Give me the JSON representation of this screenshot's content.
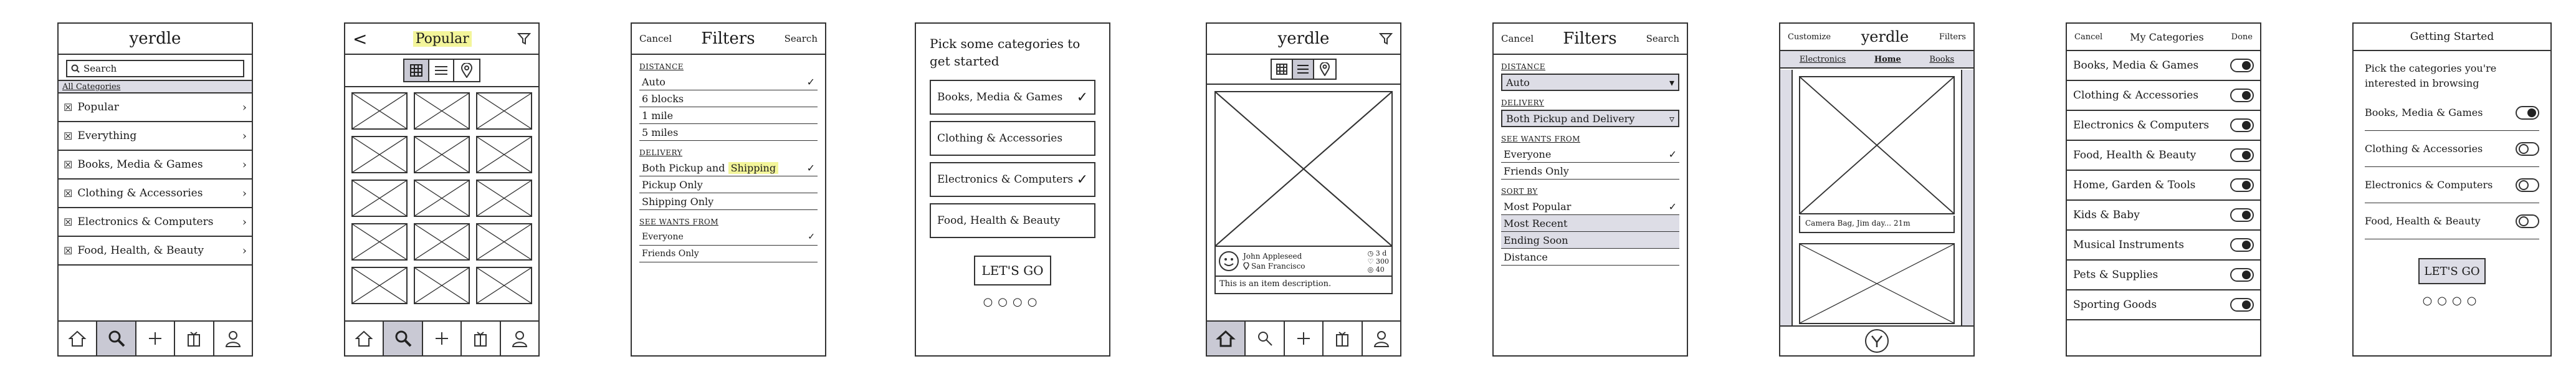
{
  "s1": {
    "title": "yerdle",
    "search_placeholder": "Search",
    "section": "All Categories",
    "items": [
      {
        "label": "Popular",
        "icon": "checkbox-icon"
      },
      {
        "label": "Everything",
        "icon": "checkbox-icon"
      },
      {
        "label": "Books, Media & Games",
        "icon": "checkbox-icon"
      },
      {
        "label": "Clothing & Accessories",
        "icon": "checkbox-icon"
      },
      {
        "label": "Electronics & Computers",
        "icon": "checkbox-icon"
      },
      {
        "label": "Food, Health, & Beauty",
        "icon": "checkbox-icon"
      }
    ],
    "tabs": [
      "home-icon",
      "search-icon",
      "plus-icon",
      "gift-icon",
      "profile-icon"
    ]
  },
  "s2": {
    "back": "<",
    "title": "Popular",
    "view_icons": [
      "grid-icon",
      "list-icon",
      "map-pin-icon"
    ]
  },
  "s3": {
    "cancel": "Cancel",
    "title": "Filters",
    "search": "Search",
    "distance_header": "Distance",
    "distance": [
      "Auto",
      "6 blocks",
      "1 mile",
      "5 miles"
    ],
    "delivery_header": "Delivery",
    "delivery_prefix": "Both Pickup and ",
    "delivery_highlight": "Shipping",
    "delivery": [
      "Pickup Only",
      "Shipping Only"
    ],
    "wants_header": "See wants from",
    "wants": [
      "Everyone",
      "Friends Only"
    ]
  },
  "s4": {
    "prompt": "Pick some categories to get started",
    "cards": [
      "Books, Media & Games",
      "Clothing & Accessories",
      "Electronics & Computers",
      "Food, Health & Beauty"
    ],
    "button": "LET'S GO",
    "dots": "○○○○"
  },
  "s5": {
    "title": "yerdle",
    "user": "John Appleseed",
    "location": "San Francisco",
    "stats": [
      "3 d",
      "300",
      "40"
    ],
    "description": "This is an item description."
  },
  "s6": {
    "cancel": "Cancel",
    "title": "Filters",
    "search": "Search",
    "distance_header": "Distance",
    "distance_value": "Auto",
    "delivery_header": "Delivery",
    "delivery_value": "Both Pickup and Delivery",
    "wants_header": "See wants from",
    "wants": [
      "Everyone",
      "Friends Only"
    ],
    "sort_header": "Sort by",
    "sort": [
      "Most Popular",
      "Most Recent",
      "Ending Soon",
      "Distance"
    ]
  },
  "s7": {
    "customize": "Customize",
    "title": "yerdle",
    "filters": "Filters",
    "tabs": [
      "Electronics",
      "Home",
      "Books"
    ],
    "caption": "Camera Bag, Jim day... 21m"
  },
  "s8": {
    "cancel": "Cancel",
    "title": "My Categories",
    "done": "Done",
    "items": [
      {
        "label": "Books, Media & Games",
        "on": true
      },
      {
        "label": "Clothing & Accessories",
        "on": true
      },
      {
        "label": "Electronics & Computers",
        "on": true
      },
      {
        "label": "Food, Health & Beauty",
        "on": true
      },
      {
        "label": "Home, Garden & Tools",
        "on": true
      },
      {
        "label": "Kids & Baby",
        "on": true
      },
      {
        "label": "Musical Instruments",
        "on": true
      },
      {
        "label": "Pets & Supplies",
        "on": true
      },
      {
        "label": "Sporting Goods",
        "on": true
      }
    ]
  },
  "s9": {
    "title": "Getting Started",
    "prompt": "Pick the categories you're interested in browsing",
    "items": [
      {
        "label": "Books, Media & Games",
        "on": true
      },
      {
        "label": "Clothing & Accessories",
        "on": false
      },
      {
        "label": "Electronics & Computers",
        "on": false
      },
      {
        "label": "Food, Health & Beauty",
        "on": false
      }
    ],
    "button": "LET'S GO",
    "dots": "○○○○"
  },
  "colors": {
    "highlight": "#f3f59a",
    "selected": "#dddde6",
    "tab_active": "#c9c9d4",
    "ink": "#333333"
  }
}
